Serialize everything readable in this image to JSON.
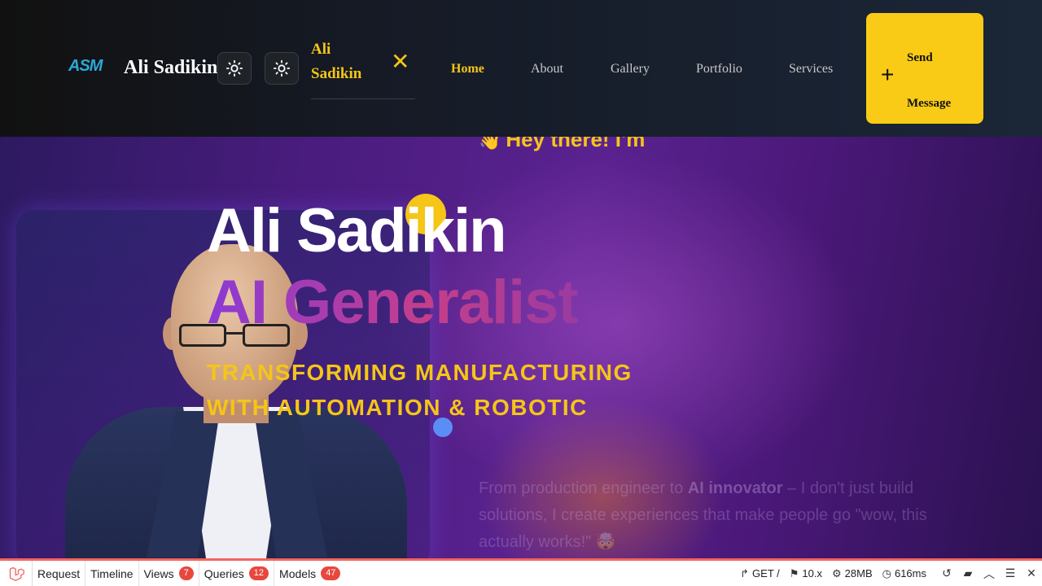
{
  "navbar": {
    "logo": "ASM",
    "brand": "Ali Sadikin",
    "menu_title": "Ali Sadikin",
    "menu_close": "✕",
    "links": [
      {
        "label": "Home",
        "active": true
      },
      {
        "label": "About",
        "active": false
      },
      {
        "label": "Gallery",
        "active": false
      },
      {
        "label": "Portfolio",
        "active": false
      },
      {
        "label": "Services",
        "active": false
      }
    ],
    "cta_plus": "+",
    "cta_line1": "Send",
    "cta_line2": "Message"
  },
  "hero": {
    "wave": "👋",
    "greeting": "Hey there! I'm",
    "name": "Ali Sadikin",
    "role": "AI Generalist",
    "tagline": "TRANSFORMING MANUFACTURING WITH AUTOMATION & ROBOTIC",
    "desc_pre": "From production engineer to",
    "desc_bold": "AI innovator",
    "desc_post": "– I don't just build solutions, I create experiences that make people go \"wow, this actually works!\" 🤯"
  },
  "debugbar": {
    "tabs": [
      {
        "label": "Request",
        "badge": null
      },
      {
        "label": "Timeline",
        "badge": null
      },
      {
        "label": "Views",
        "badge": "7"
      },
      {
        "label": "Queries",
        "badge": "12"
      },
      {
        "label": "Models",
        "badge": "47"
      }
    ],
    "route": "GET /",
    "version": "10.x",
    "memory": "28MB",
    "time": "616ms"
  },
  "colors": {
    "accent": "#f9cb16",
    "debug_red": "#f4645f",
    "logo_blue": "#2aa8d8"
  }
}
